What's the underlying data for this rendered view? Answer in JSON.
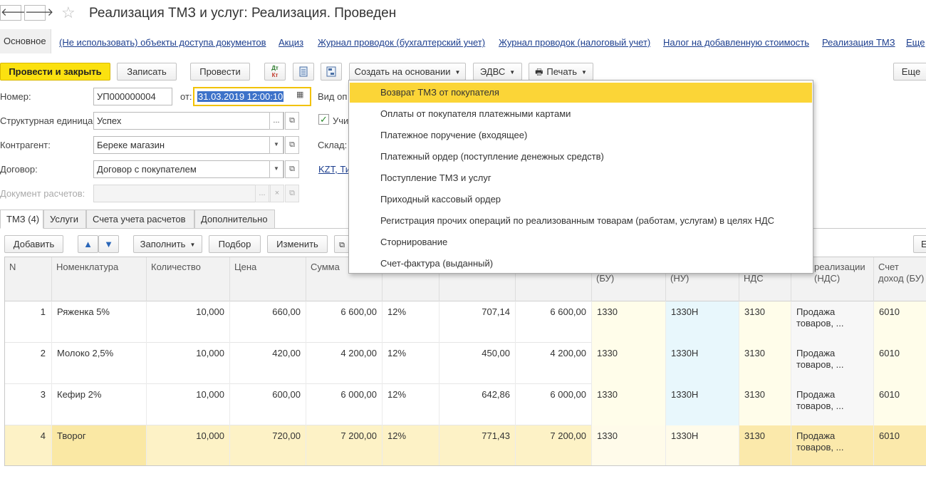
{
  "window": {
    "title": "Реализация ТМЗ и услуг: Реализация. Проведен",
    "back_glyph": "🡐",
    "forward_glyph": "🡒",
    "star_glyph": "☆"
  },
  "linkbar": {
    "main": "Основное",
    "links": [
      "(Не использовать) объекты доступа документов",
      "Акциз",
      "Журнал проводок (бухгалтерский учет)",
      "Журнал проводок (налоговый учет)",
      "Налог на добавленную стоимость",
      "Реализация ТМЗ",
      "Еще"
    ]
  },
  "toolbar": {
    "post_close": "Провести и закрыть",
    "save": "Записать",
    "post": "Провести",
    "dtkt_top": "Дт",
    "dtkt_bottom": "Кт",
    "create_based": "Создать на основании",
    "edvs": "ЭДВС",
    "print": "Печать",
    "more": "Еще"
  },
  "form": {
    "number_label": "Номер:",
    "number_value": "УП000000004",
    "date_label": "от:",
    "date_value": "31.03.2019 12:00:10",
    "op_label": "Вид оп",
    "unit_label": "Структурная единица:",
    "unit_value": "Успех",
    "account_label": "Учи",
    "contractor_label": "Контрагент:",
    "contractor_value": "Береке магазин",
    "warehouse_label": "Склад:",
    "contract_label": "Договор:",
    "contract_value": "Договор с покупателем",
    "currency_link": "KZT, Ти",
    "settlement_label": "Документ расчетов:",
    "settlement_value": ""
  },
  "tabs": [
    "ТМЗ (4)",
    "Услуги",
    "Счета учета расчетов",
    "Дополнительно"
  ],
  "table_toolbar": {
    "add": "Добавить",
    "fill": "Заполнить",
    "select": "Подбор",
    "change": "Изменить",
    "more_short": "Е"
  },
  "table": {
    "headers": [
      "N",
      "Номенклатура",
      "Количество",
      "Цена",
      "Сумма",
      "",
      "",
      "",
      "(БУ)",
      "(НУ)",
      "НДС",
      "реализации (НДС)",
      "Счет доход (БУ)"
    ],
    "rows": [
      [
        "1",
        "Ряженка 5%",
        "10,000",
        "660,00",
        "6 600,00",
        "12%",
        "707,14",
        "6 600,00",
        "1330",
        "1330Н",
        "3130",
        "Продажа товаров, ...",
        "6010"
      ],
      [
        "2",
        "Молоко 2,5%",
        "10,000",
        "420,00",
        "4 200,00",
        "12%",
        "450,00",
        "4 200,00",
        "1330",
        "1330Н",
        "3130",
        "Продажа товаров, ...",
        "6010"
      ],
      [
        "3",
        "Кефир 2%",
        "10,000",
        "600,00",
        "6 000,00",
        "12%",
        "642,86",
        "6 000,00",
        "1330",
        "1330Н",
        "3130",
        "Продажа товаров, ...",
        "6010"
      ],
      [
        "4",
        "Творог",
        "10,000",
        "720,00",
        "7 200,00",
        "12%",
        "771,43",
        "7 200,00",
        "1330",
        "1330Н",
        "3130",
        "Продажа товаров, ...",
        "6010"
      ]
    ],
    "selected_row": 3
  },
  "dropdown": {
    "items": [
      "Возврат ТМЗ от покупателя",
      "Оплаты от покупателя платежными картами",
      "Платежное поручение (входящее)",
      "Платежный ордер (поступление денежных средств)",
      "Поступление ТМЗ и услуг",
      "Приходный кассовый ордер",
      "Регистрация прочих операций по реализованным товарам (работам, услугам) в целях НДС",
      "Сторнирование",
      "Счет-фактура (выданный)"
    ],
    "selected_index": 0
  },
  "colors": {
    "accent_yellow": "#fbe110",
    "link": "#1c3e8e",
    "selection": "#fbd537"
  }
}
